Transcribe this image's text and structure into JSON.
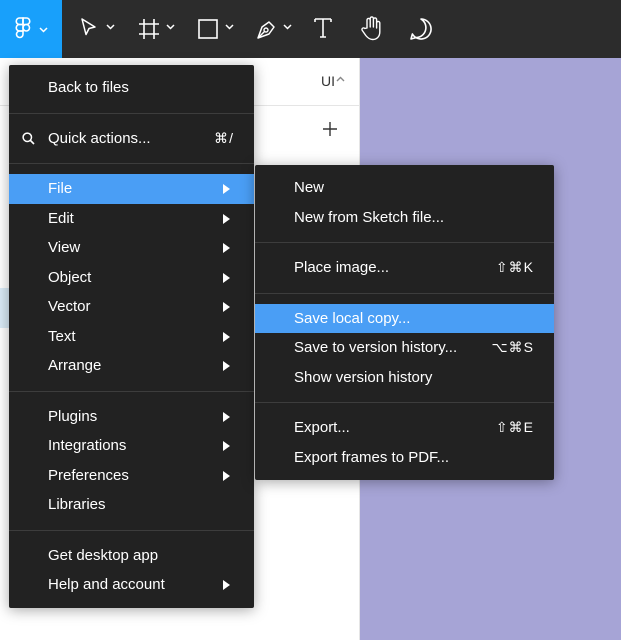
{
  "toolbar": {
    "tools": [
      "main-menu",
      "move",
      "frame",
      "shape",
      "pen",
      "text",
      "hand",
      "comment"
    ],
    "accent": "#18a0fb"
  },
  "panel": {
    "page_label": "UI"
  },
  "main_menu": {
    "back_to_files": "Back to files",
    "quick_actions": "Quick actions...",
    "quick_actions_shortcut": "⌘/",
    "items_group1": [
      "File",
      "Edit",
      "View",
      "Object",
      "Vector",
      "Text",
      "Arrange"
    ],
    "items_group2": [
      "Plugins",
      "Integrations",
      "Preferences",
      "Libraries"
    ],
    "get_desktop_app": "Get desktop app",
    "help_and_account": "Help and account"
  },
  "file_menu": {
    "new": "New",
    "new_from_sketch": "New from Sketch file...",
    "place_image": "Place image...",
    "place_image_shortcut": "⇧⌘K",
    "save_local_copy": "Save local copy...",
    "save_to_version_history": "Save to version history...",
    "save_to_version_history_shortcut": "⌥⌘S",
    "show_version_history": "Show version history",
    "export": "Export...",
    "export_shortcut": "⇧⌘E",
    "export_frames_pdf": "Export frames to PDF..."
  },
  "colors": {
    "menu_bg": "#222222",
    "highlight": "#4a9ef5",
    "canvas": "#a6a4d6"
  }
}
